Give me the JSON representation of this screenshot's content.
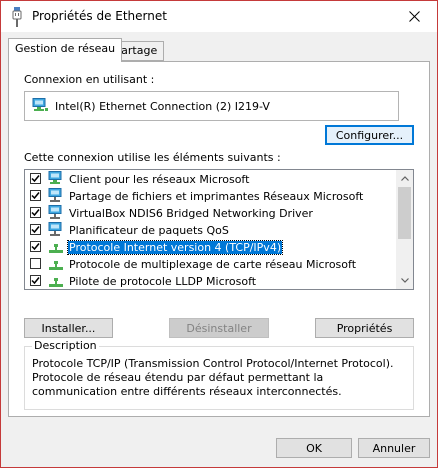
{
  "window": {
    "title": "Propriétés de Ethernet"
  },
  "tabs": [
    {
      "label": "Gestion de réseau",
      "active": true
    },
    {
      "label": "Partage",
      "active": false
    }
  ],
  "connection": {
    "label": "Connexion en utilisant :",
    "adapter": "Intel(R) Ethernet Connection (2) I219-V",
    "configure_button": "Configurer..."
  },
  "items": {
    "label": "Cette connexion utilise les éléments suivants :",
    "list": [
      {
        "label": "Client pour les réseaux Microsoft",
        "checked": true,
        "icon": "network-client-icon"
      },
      {
        "label": "Partage de fichiers et imprimantes Réseaux Microsoft",
        "checked": true,
        "icon": "network-service-icon"
      },
      {
        "label": "VirtualBox NDIS6 Bridged Networking Driver",
        "checked": true,
        "icon": "network-service-icon"
      },
      {
        "label": "Planificateur de paquets QoS",
        "checked": true,
        "icon": "network-service-icon"
      },
      {
        "label": "Protocole Internet version 4 (TCP/IPv4)",
        "checked": true,
        "icon": "protocol-icon",
        "selected": true
      },
      {
        "label": "Protocole de multiplexage de carte réseau Microsoft",
        "checked": false,
        "icon": "protocol-icon"
      },
      {
        "label": "Pilote de protocole LLDP Microsoft",
        "checked": true,
        "icon": "protocol-icon"
      }
    ]
  },
  "buttons": {
    "install": "Installer...",
    "uninstall": "Désinstaller",
    "properties": "Propriétés",
    "ok": "OK",
    "cancel": "Annuler"
  },
  "description": {
    "title": "Description",
    "text": "Protocole TCP/IP (Transmission Control Protocol/Internet Protocol). Protocole de réseau étendu par défaut permettant la communication entre différents réseaux interconnectés."
  },
  "colors": {
    "selection": "#0078d7",
    "window_border": "#c53a3a",
    "focus": "#0078d7"
  }
}
